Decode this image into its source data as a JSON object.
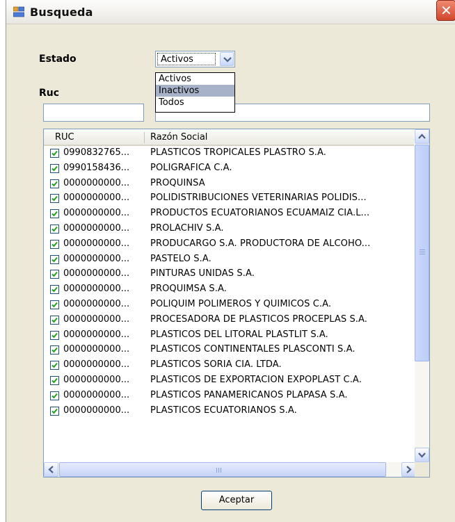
{
  "window": {
    "title": "Busqueda",
    "close_glyph": "✕"
  },
  "form": {
    "estado_label": "Estado",
    "estado_value": "Activos",
    "estado_options": [
      "Activos",
      "Inactivos",
      "Todos"
    ],
    "estado_highlighted": "Inactivos",
    "ruc_label": "Ruc",
    "ruc_value": "",
    "razon_value": ""
  },
  "grid": {
    "columns": [
      "RUC",
      "Razón Social"
    ],
    "rows": [
      {
        "ruc": "0990832765...",
        "razon": "PLASTICOS TROPICALES PLASTRO S.A.",
        "checked": true
      },
      {
        "ruc": "0990158436...",
        "razon": "POLIGRAFICA C.A.",
        "checked": true
      },
      {
        "ruc": "0000000000...",
        "razon": "PROQUINSA",
        "checked": true
      },
      {
        "ruc": "0000000000...",
        "razon": "POLIDISTRIBUCIONES VETERINARIAS POLIDIS...",
        "checked": true
      },
      {
        "ruc": "0000000000...",
        "razon": "PRODUCTOS ECUATORIANOS ECUAMAIZ CIA.L...",
        "checked": true
      },
      {
        "ruc": "0000000000...",
        "razon": "PROLACHIV S.A.",
        "checked": true
      },
      {
        "ruc": "0000000000...",
        "razon": "PRODUCARGO S.A. PRODUCTORA DE ALCOHO...",
        "checked": true
      },
      {
        "ruc": "0000000000...",
        "razon": "PASTELO  S.A.",
        "checked": true
      },
      {
        "ruc": "0000000000...",
        "razon": "PINTURAS UNIDAS S.A.",
        "checked": true
      },
      {
        "ruc": "0000000000...",
        "razon": "PROQUIMSA S.A.",
        "checked": true
      },
      {
        "ruc": "0000000000...",
        "razon": "POLIQUIM POLIMEROS Y QUIMICOS C.A.",
        "checked": true
      },
      {
        "ruc": "0000000000...",
        "razon": "PROCESADORA DE PLASTICOS PROCEPLAS S.A.",
        "checked": true
      },
      {
        "ruc": "0000000000...",
        "razon": "PLASTICOS DEL LITORAL PLASTLIT S.A.",
        "checked": true
      },
      {
        "ruc": "0000000000...",
        "razon": "PLASTICOS CONTINENTALES PLASCONTI S.A.",
        "checked": true
      },
      {
        "ruc": "0000000000...",
        "razon": "PLASTICOS SORIA CIA. LTDA.",
        "checked": true
      },
      {
        "ruc": "0000000000...",
        "razon": "PLASTICOS DE EXPORTACION EXPOPLAST C.A.",
        "checked": true
      },
      {
        "ruc": "0000000000...",
        "razon": "PLASTICOS PANAMERICANOS PLAPASA S.A.",
        "checked": true
      },
      {
        "ruc": "0000000000...",
        "razon": "PLASTICOS ECUATORIANOS S.A.",
        "checked": true
      }
    ]
  },
  "buttons": {
    "accept_label": "Aceptar"
  },
  "colors": {
    "window_bg": "#ECE9D8",
    "checkbox_check": "#21a121",
    "close_red": "#d0462c"
  },
  "icons": {
    "app": "window-app-icon",
    "close": "close-icon",
    "check": "check-icon"
  }
}
